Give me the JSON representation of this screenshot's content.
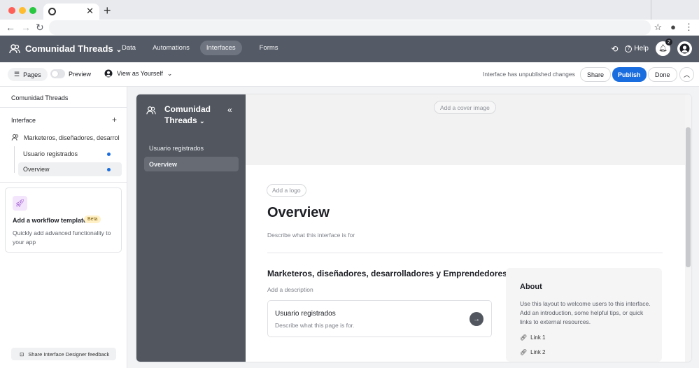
{
  "browser": {
    "traffic_colors": [
      "#ff5f57",
      "#febc2e",
      "#28c840"
    ]
  },
  "app": {
    "name": "Comunidad Threads",
    "nav": [
      "Data",
      "Automations",
      "Interfaces",
      "Forms"
    ],
    "active_nav": "Interfaces",
    "help_label": "Help",
    "notification_count": "2"
  },
  "toolbar": {
    "pages_label": "Pages",
    "preview_label": "Preview",
    "view_as_label": "View as Yourself",
    "status_text": "Interface has unpublished changes",
    "share_label": "Share",
    "publish_label": "Publish",
    "done_label": "Done"
  },
  "sidebar": {
    "title": "Comunidad Threads",
    "section_label": "Interface",
    "group_label": "Marketeros, diseñadores, desarrol",
    "pages": [
      {
        "label": "Usuario registrados"
      },
      {
        "label": "Overview"
      }
    ],
    "workflow_card": {
      "title": "Add a workflow template",
      "badge": "Beta",
      "description": "Quickly add advanced functionality to your app"
    },
    "feedback_label": "Share Interface Designer feedback"
  },
  "preview": {
    "app_name_line1": "Comunidad",
    "app_name_line2": "Threads",
    "nav": [
      "Usuario registrados",
      "Overview"
    ],
    "cover_button": "Add a cover image",
    "logo_button": "Add a logo",
    "page_title": "Overview",
    "page_description": "Describe what this interface is for",
    "section_title": "Marketeros, diseñadores, desarrolladores y Emprendedores",
    "section_description": "Add a description",
    "page_card": {
      "title": "Usuario registrados",
      "description": "Describe what this page is for."
    },
    "about": {
      "title": "About",
      "description": "Use this layout to welcome users to this interface. Add an introduction, some helpful tips, or quick links to external resources.",
      "links": [
        "Link 1",
        "Link 2"
      ]
    }
  },
  "colors": {
    "header_bg": "#555b66",
    "publish_blue": "#1a6ddf",
    "preview_sidebar": "#51565f"
  }
}
